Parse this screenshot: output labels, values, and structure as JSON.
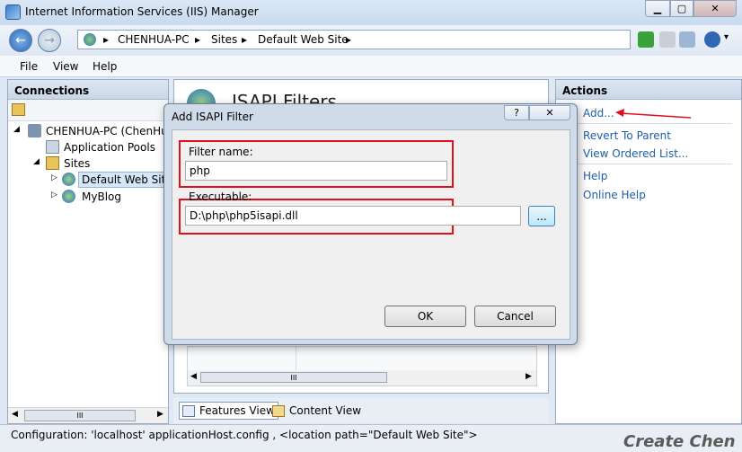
{
  "window": {
    "title": "Internet Information Services (IIS) Manager"
  },
  "address": {
    "crumbs": [
      "CHENHUA-PC",
      "Sites",
      "Default Web Site"
    ],
    "separator": "▸"
  },
  "menu": [
    "File",
    "View",
    "Help"
  ],
  "connections": {
    "header": "Connections",
    "tree": [
      {
        "label": "CHENHUA-PC (ChenHua"
      },
      {
        "label": "Application Pools"
      },
      {
        "label": "Sites"
      },
      {
        "label": "Default Web Site"
      },
      {
        "label": "MyBlog"
      }
    ],
    "scrollbar_grip": "III"
  },
  "center": {
    "title": "ISAPI Filters",
    "scrollbar_grip": "III"
  },
  "view_tabs": {
    "features": "Features View",
    "content": "Content View"
  },
  "actions": {
    "header": "Actions",
    "links": [
      "Add...",
      "Revert To Parent",
      "View Ordered List...",
      "Help",
      "Online Help"
    ]
  },
  "dialog": {
    "title": "Add ISAPI Filter",
    "help_glyph": "?",
    "close_glyph": "✕",
    "filter_name_label": "Filter name:",
    "filter_name_value": "php",
    "executable_label": "Executable:",
    "executable_value": "D:\\php\\php5isapi.dll",
    "browse_label": "...",
    "ok_label": "OK",
    "cancel_label": "Cancel"
  },
  "status": {
    "text": "Configuration: 'localhost' applicationHost.config , <location path=\"Default Web Site\">"
  },
  "watermark": "Create Chen",
  "colors": {
    "highlight": "#e0101a",
    "link": "#1e5fa6"
  }
}
